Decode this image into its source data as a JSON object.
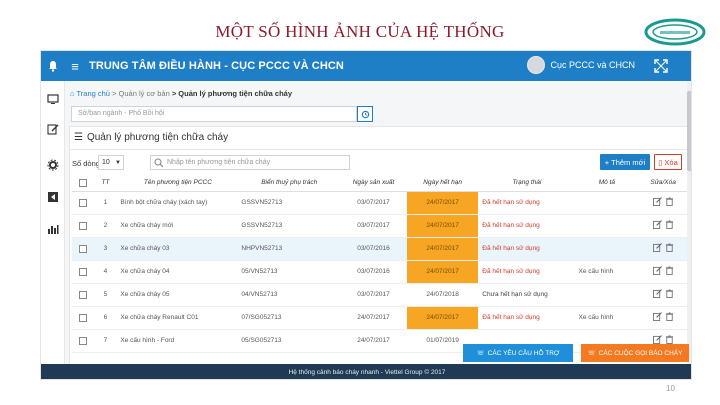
{
  "slide": {
    "title": "MỘT SỐ HÌNH ẢNH CỦA HỆ THỐNG",
    "page_number": "10"
  },
  "colors": {
    "header": "#1e7fc6",
    "accent_orange": "#f37a21",
    "footer": "#1f3a52",
    "danger": "#d23c2a"
  },
  "app": {
    "header_title": "TRUNG TÂM ĐIỀU HÀNH - CỤC PCCC VÀ CHCN",
    "user_name": "Cục PCCC và CHCN"
  },
  "sidebar": {
    "icons": [
      "monitor-icon",
      "edit-icon",
      "gear-icon",
      "share-icon",
      "bar-chart-icon"
    ]
  },
  "breadcrumb": {
    "home": "Trang chủ",
    "mid": "> Quản lý cơ bản",
    "current": "> Quản lý phương tiện chữa cháy"
  },
  "search": {
    "placeholder": "Sở/ban ngành - Phố Bồi hội"
  },
  "panel": {
    "title": "Quản lý phương tiện chữa cháy",
    "page_size_label": "Số dòng",
    "page_size": "10",
    "search_placeholder": "Nhập tên phương tiện chữa cháy",
    "add_label": "+ Thêm mới",
    "delete_label": "Xóa"
  },
  "table": {
    "headers": [
      "TT",
      "Tên phương tiện PCCC",
      "Biển thuỷ phụ trách",
      "Ngày sản xuất",
      "Ngày hết hạn",
      "Trạng thái",
      "Mô tả",
      "Sửa/Xóa"
    ],
    "rows": [
      {
        "tt": "1",
        "name": "Bình bột chữa cháy (xách tay)",
        "plate": "GSSVN52713",
        "mfg": "03/07/2017",
        "exp": "24/07/2017",
        "status": "Đã hết hạn sử dụng",
        "desc": "",
        "exp_highlight": true,
        "status_red": true,
        "highlight": false
      },
      {
        "tt": "2",
        "name": "Xe chữa cháy mới",
        "plate": "GSSVN52713",
        "mfg": "03/07/2017",
        "exp": "24/07/2017",
        "status": "Đã hết hạn sử dụng",
        "desc": "",
        "exp_highlight": true,
        "status_red": true,
        "highlight": false
      },
      {
        "tt": "3",
        "name": "Xe chữa cháy 03",
        "plate": "NHPVN52713",
        "mfg": "03/07/2016",
        "exp": "24/07/2017",
        "status": "Đã hết hạn sử dụng",
        "desc": "",
        "exp_highlight": true,
        "status_red": true,
        "highlight": true
      },
      {
        "tt": "4",
        "name": "Xe chữa cháy 04",
        "plate": "05/VN52713",
        "mfg": "03/07/2016",
        "exp": "24/07/2017",
        "status": "Đã hết hạn sử dụng",
        "desc": "Xe cấu hình",
        "exp_highlight": true,
        "status_red": true,
        "highlight": false
      },
      {
        "tt": "5",
        "name": "Xe chữa cháy 05",
        "plate": "04/VN52713",
        "mfg": "03/07/2017",
        "exp": "24/07/2018",
        "status": "Chưa hết hạn sử dụng",
        "desc": "",
        "exp_highlight": false,
        "status_red": false,
        "highlight": false
      },
      {
        "tt": "6",
        "name": "Xe chữa cháy Renault C01",
        "plate": "07/SG052713",
        "mfg": "24/07/2017",
        "exp": "24/07/2017",
        "status": "Đã hết hạn sử dụng",
        "desc": "Xe cấu hình",
        "exp_highlight": true,
        "status_red": true,
        "highlight": false
      },
      {
        "tt": "7",
        "name": "Xe cấu hình - Ford",
        "plate": "05/SG052713",
        "mfg": "24/07/2017",
        "exp": "01/07/2019",
        "status": "",
        "desc": "",
        "exp_highlight": false,
        "status_red": false,
        "highlight": false
      }
    ]
  },
  "floating": {
    "request_label": "CÁC YÊU CẦU HỖ TRỢ",
    "alarm_label": "CÁC CUỘC GỌI BÁO CHÁY"
  },
  "footer": {
    "text": "Hệ thống cảnh báo cháy nhanh - Viettel Group © 2017"
  }
}
